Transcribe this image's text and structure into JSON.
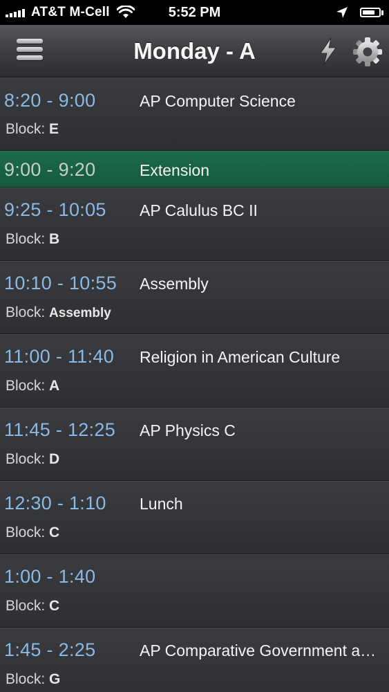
{
  "status_bar": {
    "carrier": "AT&T M-Cell",
    "time": "5:52 PM",
    "battery_level": 0.75,
    "icons": [
      "signal-bars-icon",
      "wifi-icon",
      "location-arrow-icon",
      "battery-icon"
    ]
  },
  "nav": {
    "title": "Monday - A",
    "left_icon": "hamburger-menu-icon",
    "right_icons": [
      "lightning-bolt-icon",
      "gear-icon"
    ]
  },
  "colors": {
    "time_text": "#8ab9e6",
    "highlight_row": "#1c6a4a",
    "row_bg": "#35363a"
  },
  "block_label": "Block:",
  "schedule": [
    {
      "time": "8:20 - 9:00",
      "title": "AP Computer Science",
      "block": "E"
    },
    {
      "time": "9:00 - 9:20",
      "title": "Extension",
      "highlight": true
    },
    {
      "time": "9:25 - 10:05",
      "title": "AP Calulus BC II",
      "block": "B"
    },
    {
      "time": "10:10 - 10:55",
      "title": "Assembly",
      "block": "Assembly"
    },
    {
      "time": "11:00 - 11:40",
      "title": "Religion in American Culture",
      "block": "A"
    },
    {
      "time": "11:45 - 12:25",
      "title": "AP Physics C",
      "block": "D"
    },
    {
      "time": "12:30 - 1:10",
      "title": "Lunch",
      "block": "C"
    },
    {
      "time": "1:00 - 1:40",
      "title": "",
      "block": "C"
    },
    {
      "time": "1:45 - 2:25",
      "title": "AP Comparative Government and Politics",
      "block": "G"
    }
  ]
}
